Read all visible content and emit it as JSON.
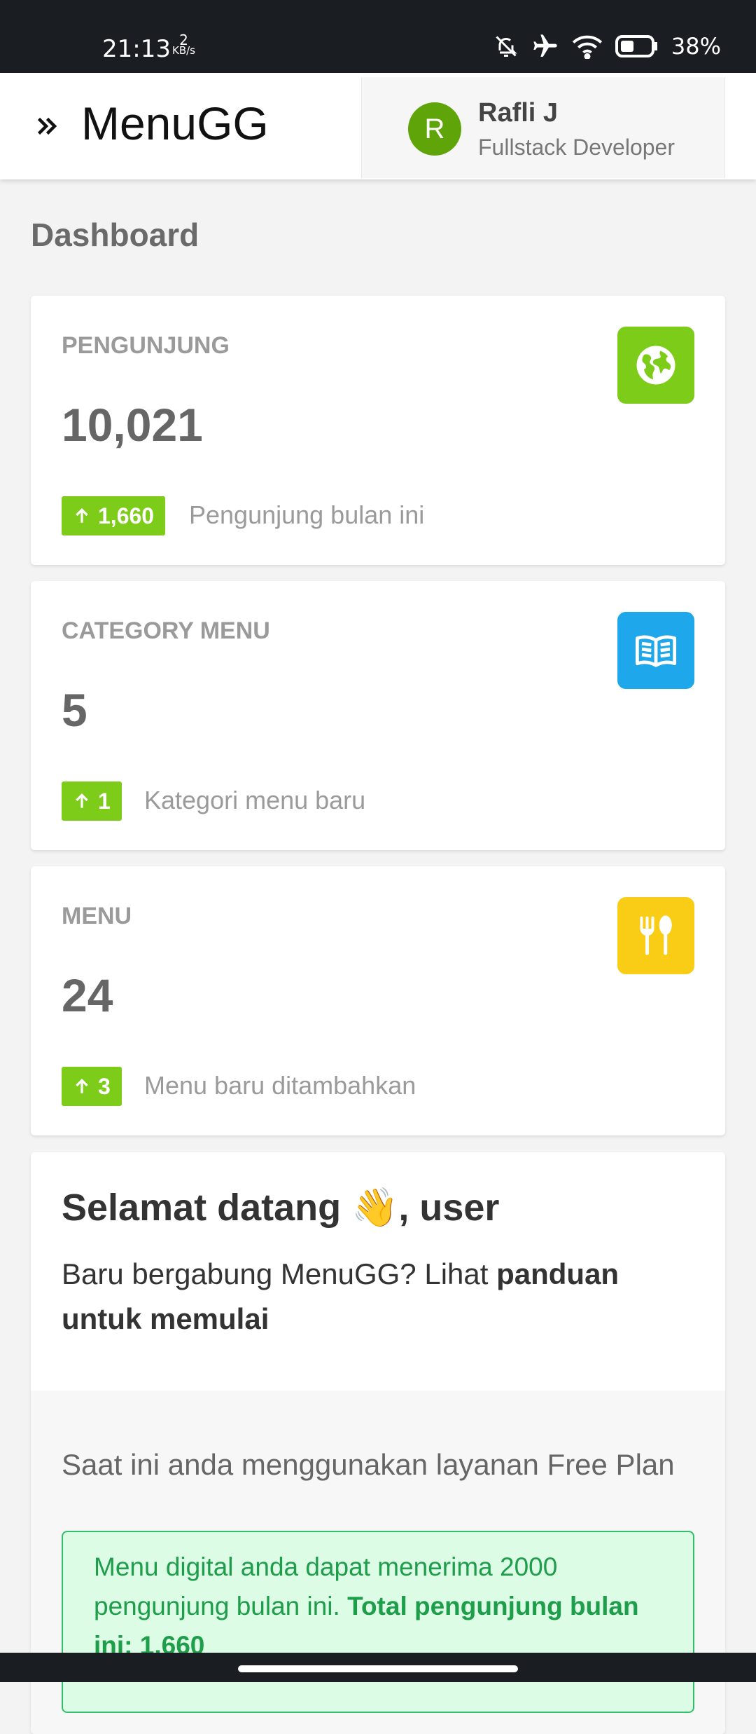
{
  "status_bar": {
    "time": "21:13",
    "net_speed": "2",
    "net_unit": "KB/s",
    "battery": "38%"
  },
  "navbar": {
    "brand": "MenuGG",
    "user": {
      "initial": "R",
      "name": "Rafli J",
      "role": "Fullstack Developer",
      "avatar_color": "#5fa50a"
    }
  },
  "page": {
    "title": "Dashboard"
  },
  "stats": [
    {
      "label": "PENGUNJUNG",
      "value": "10,021",
      "badge": "1,660",
      "note": "Pengunjung bulan ini",
      "icon": "globe-icon",
      "icon_color": "#7ccc19"
    },
    {
      "label": "CATEGORY MENU",
      "value": "5",
      "badge": "1",
      "note": "Kategori menu baru",
      "icon": "book-open-icon",
      "icon_color": "#1ea7ea"
    },
    {
      "label": "MENU",
      "value": "24",
      "badge": "3",
      "note": "Menu baru ditambahkan",
      "icon": "utensils-icon",
      "icon_color": "#f9cc16"
    }
  ],
  "welcome": {
    "title": "Selamat datang 👋, user",
    "text_prefix": "Baru bergabung MenuGG? Lihat ",
    "guide_link": "panduan untuk memulai",
    "plan_text": "Saat ini anda menggunakan layanan Free Plan",
    "alert_text": "Menu digital anda dapat menerima 2000 pengunjung bulan ini. ",
    "alert_bold": "Total pengunjung bulan ini: 1.660"
  },
  "colors": {
    "badge_green": "#7ccc19",
    "alert_bg": "#dcfce5",
    "alert_text": "#1e9d4b"
  }
}
